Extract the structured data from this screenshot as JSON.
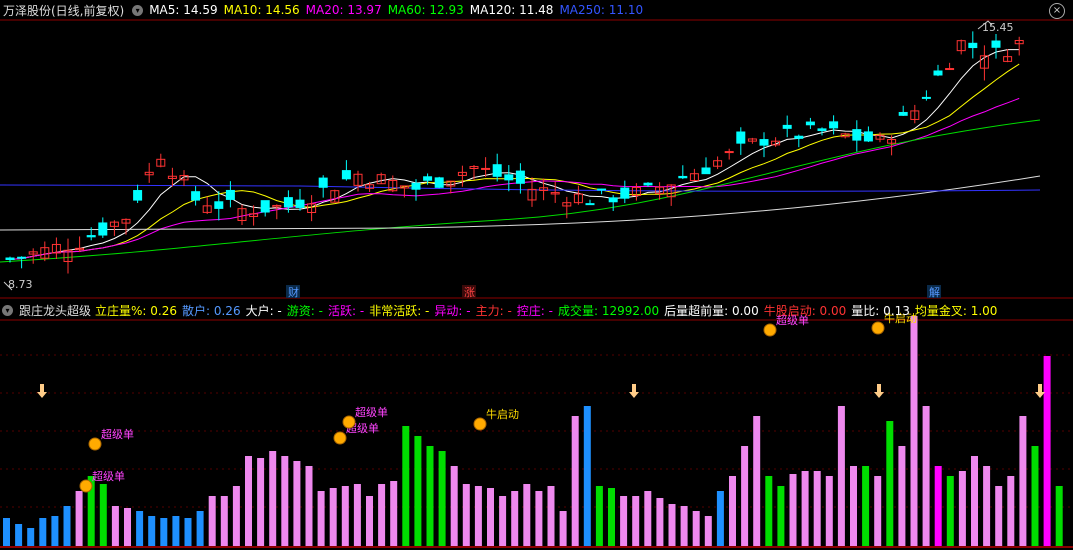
{
  "header": {
    "stock_title": "万泽股份(日线,前复权)",
    "ma": [
      {
        "label": "MA5: 14.59",
        "color": "#ffffff"
      },
      {
        "label": "MA10: 14.56",
        "color": "#ffff00"
      },
      {
        "label": "MA20: 13.97",
        "color": "#ff00ff"
      },
      {
        "label": "MA60: 12.93",
        "color": "#00ff00"
      },
      {
        "label": "MA120: 11.48",
        "color": "#ffffff"
      },
      {
        "label": "MA250: 11.10",
        "color": "#3355ff"
      }
    ],
    "close_button": "×"
  },
  "price_labels": {
    "high": "15.45",
    "low": "8.73"
  },
  "event_markers": [
    {
      "text": "财",
      "color": "#5599ff"
    },
    {
      "text": "涨",
      "color": "#ff4444"
    },
    {
      "text": "解",
      "color": "#5599ff"
    }
  ],
  "indicator": {
    "name": "跟庄龙头超级",
    "items": [
      {
        "label": "立庄量%:",
        "value": "0.26",
        "color": "#ffff00"
      },
      {
        "label": "散户:",
        "value": "0.26",
        "color": "#5599ff"
      },
      {
        "label": "大户:",
        "value": "-",
        "color": "#ffffff"
      },
      {
        "label": "游资:",
        "value": "-",
        "color": "#00ff00"
      },
      {
        "label": "活跃:",
        "value": "-",
        "color": "#ff00ff"
      },
      {
        "label": "非常活跃:",
        "value": "-",
        "color": "#ffff00"
      },
      {
        "label": "异动:",
        "value": "-",
        "color": "#ff00ff"
      },
      {
        "label": "主力:",
        "value": "-",
        "color": "#ff3333"
      },
      {
        "label": "控庄:",
        "value": "-",
        "color": "#ff00ff"
      },
      {
        "label": "成交量:",
        "value": "12992.00",
        "color": "#00ff00"
      },
      {
        "label": "后量超前量:",
        "value": "0.00",
        "color": "#ffffff"
      },
      {
        "label": "牛股启动:",
        "value": "0.00",
        "color": "#ff3333"
      },
      {
        "label": "量比:",
        "value": "0.13",
        "color": "#ffffff"
      },
      {
        "label": "均量金叉:",
        "value": "1.00",
        "color": "#ffff00"
      }
    ]
  },
  "annotations": {
    "super_order": "超级单",
    "bull_start": "牛启动"
  },
  "colors": {
    "up": "#ff3333",
    "down": "#00ffff",
    "vol_blue": "#1e90ff",
    "vol_pink": "#ee88ee",
    "vol_green": "#00dd00",
    "vol_magenta": "#ff00ff"
  }
}
